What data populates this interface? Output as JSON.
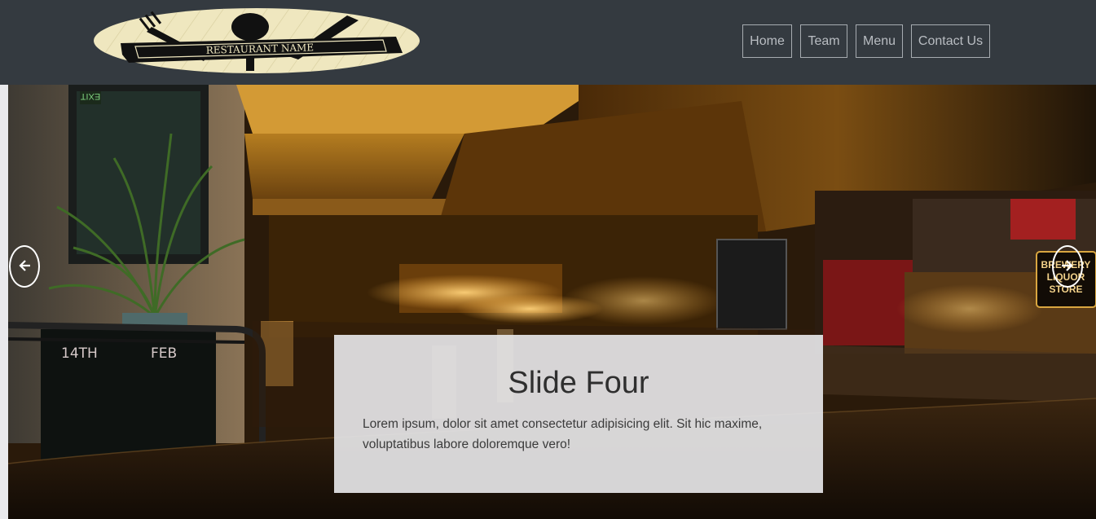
{
  "header": {
    "logo_text": "RESTAURANT NAME",
    "nav": [
      {
        "label": "Home"
      },
      {
        "label": "Team"
      },
      {
        "label": "Menu"
      },
      {
        "label": "Contact Us"
      }
    ]
  },
  "carousel": {
    "slide": {
      "title": "Slide Four",
      "text": "Lorem ipsum, dolor sit amet consectetur adipisicing elit. Sit hic maxime, voluptatibus labore doloremque vero!",
      "photo_text": [
        "14TH",
        "FEB",
        "BREWERY",
        "LIQUOR",
        "STORE",
        "EXIT"
      ]
    },
    "prev_icon": "arrow-left-icon",
    "next_icon": "arrow-right-icon"
  },
  "colors": {
    "navbar": "#343a40",
    "nav_border": "#a7acb1",
    "caption_bg": "#e4e4e6"
  }
}
